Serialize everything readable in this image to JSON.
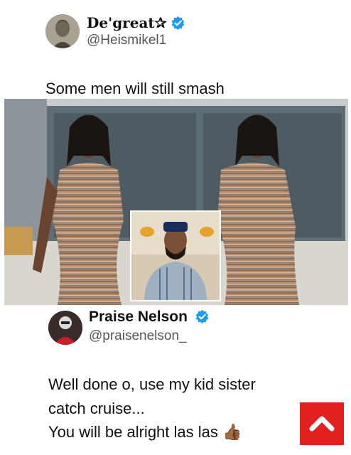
{
  "first_tweet": {
    "display_name": "De'great✰",
    "handle": "@Heismikel1",
    "text": "Some men will still smash"
  },
  "reply_tweet": {
    "display_name": "Praise Nelson",
    "handle": "@praisenelson_",
    "text_lines": [
      "Well done o, use my kid sister",
      "catch cruise...",
      "You will be alright las las"
    ],
    "emoji": "👍🏾"
  },
  "icons": {
    "verified": "verified-badge-icon",
    "scroll_top": "chevron-up-icon"
  },
  "colors": {
    "verified_blue": "#1d9bf0",
    "scroll_button": "#e0211f"
  }
}
